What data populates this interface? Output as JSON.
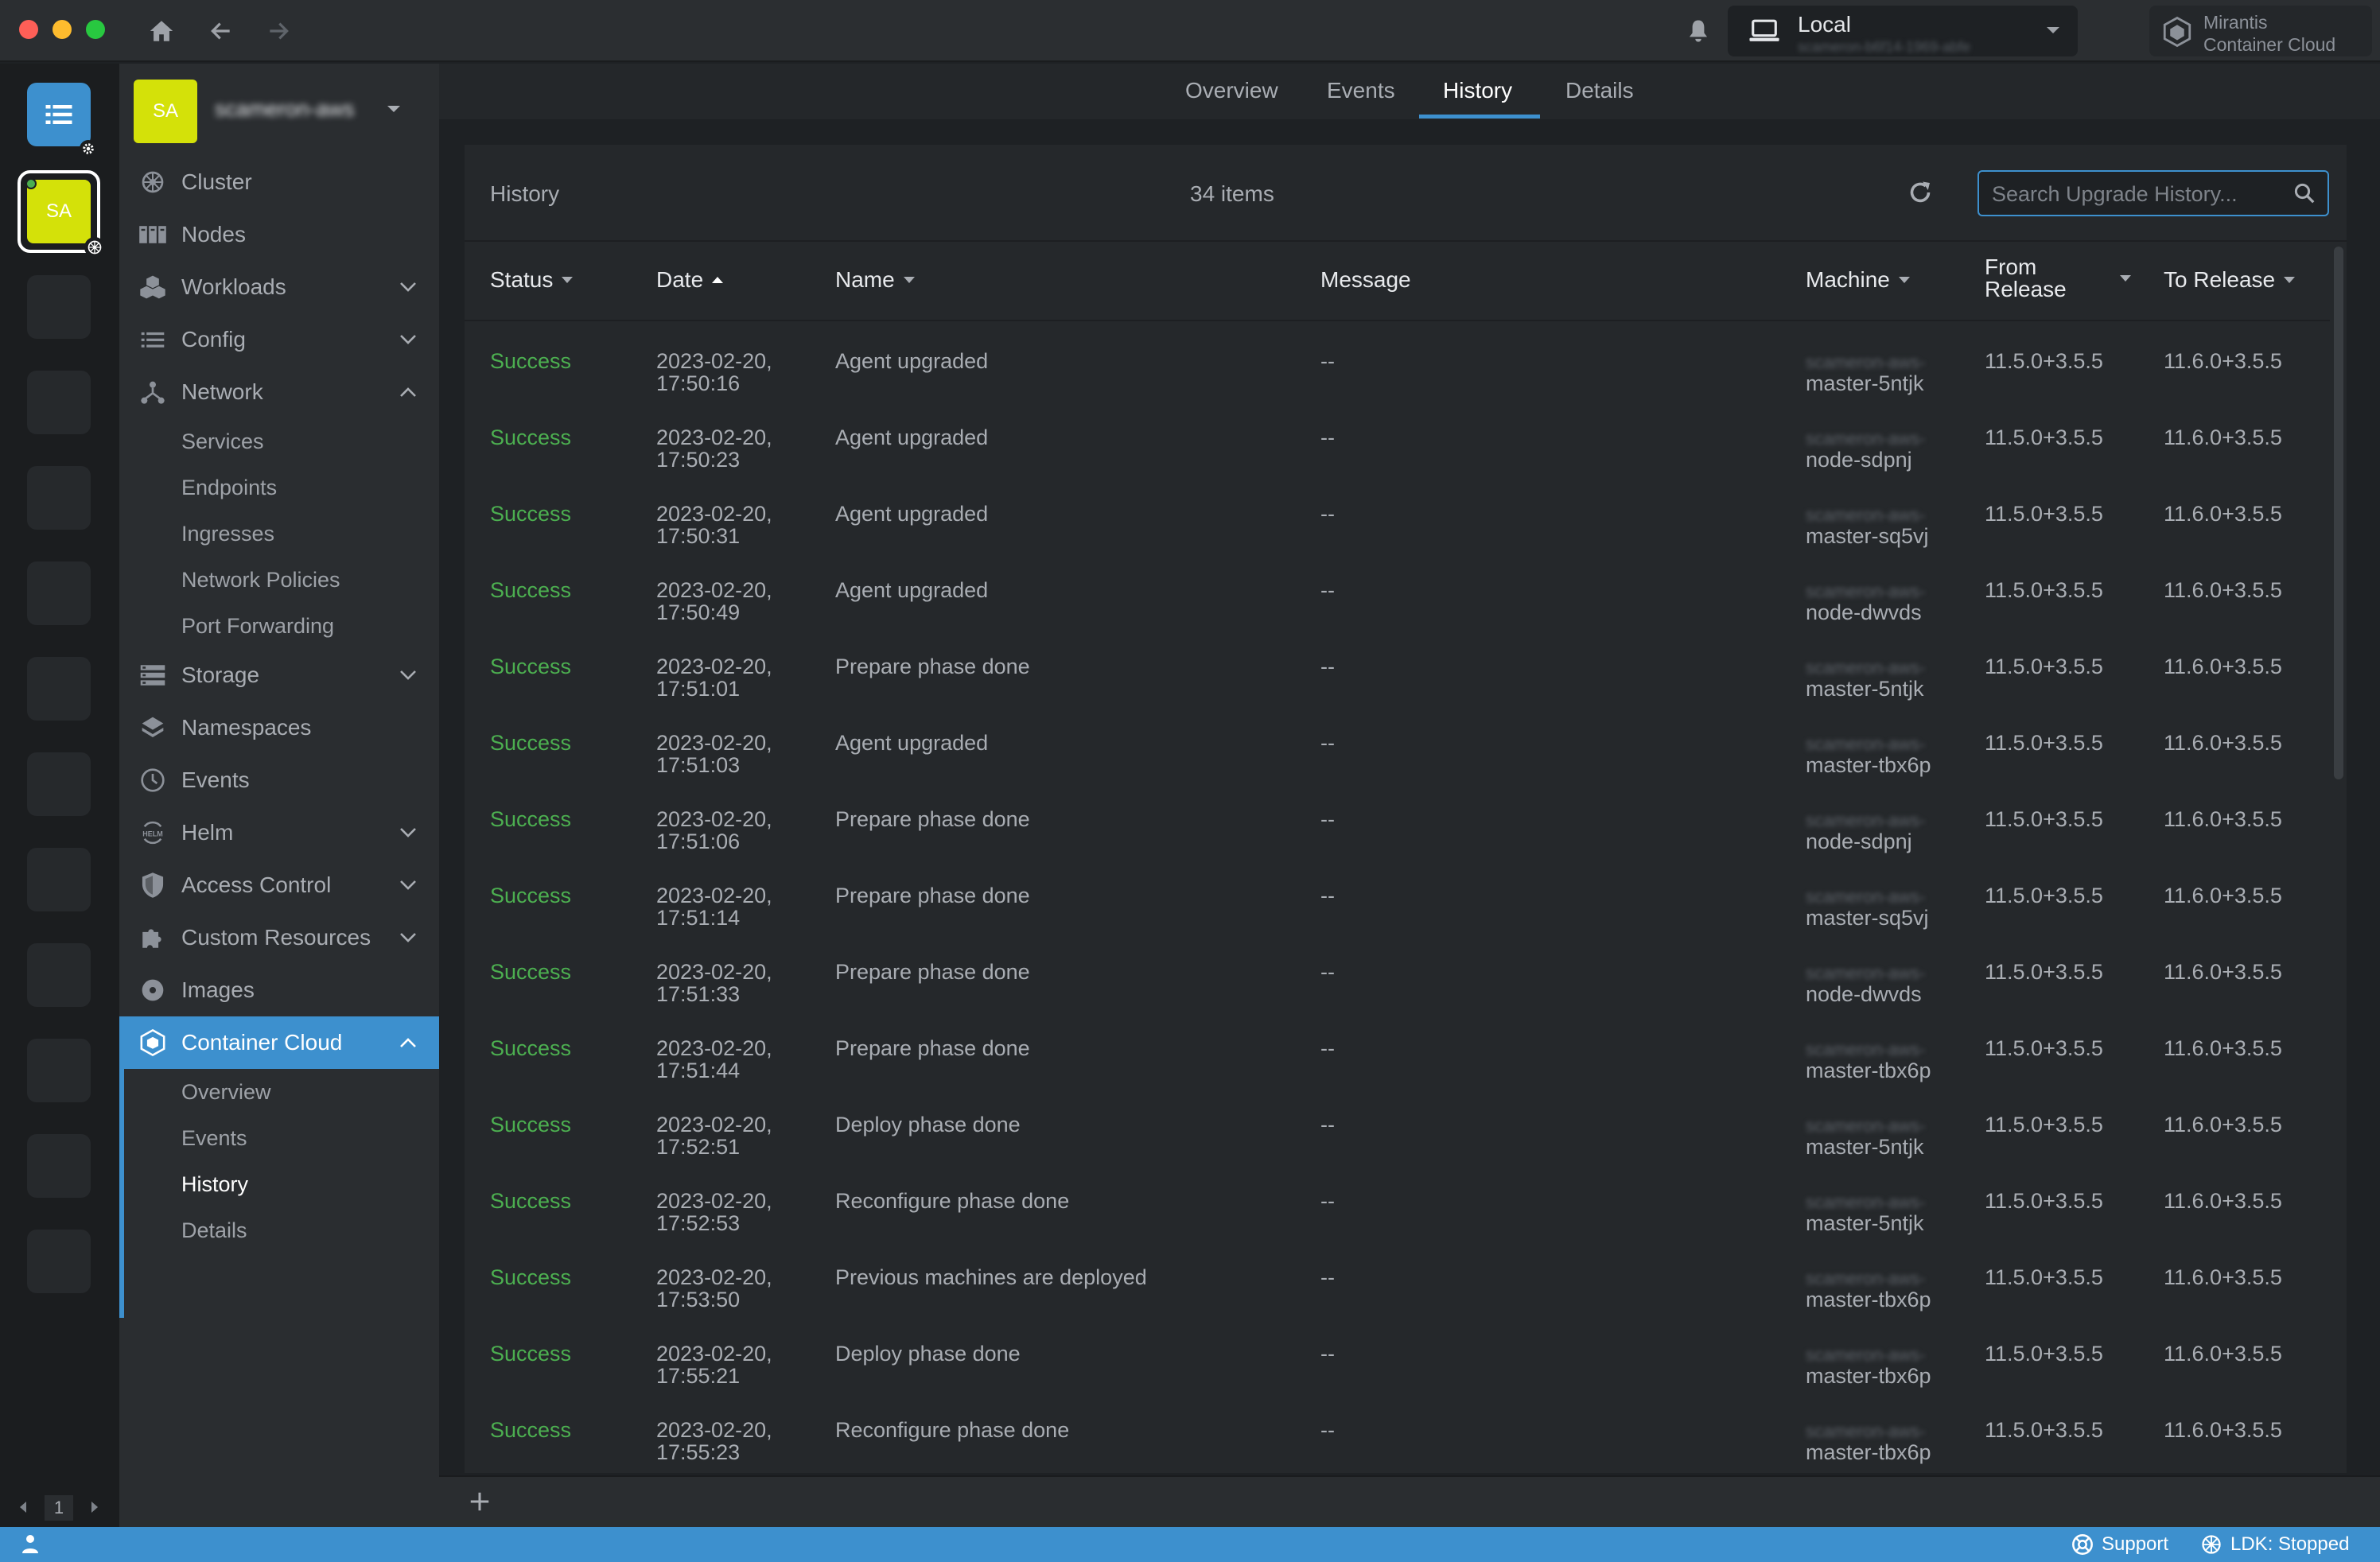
{
  "topbar": {
    "cluster_name": "Local",
    "cluster_id": "scameron-b6f14-1969-abfe",
    "brand_line1": "Mirantis",
    "brand_line2": "Container Cloud"
  },
  "hotbar": {
    "active_initials": "SA",
    "page": "1"
  },
  "workspace": {
    "initials": "SA",
    "name": "scameron-aws"
  },
  "sidebar": {
    "items": [
      {
        "label": "Cluster"
      },
      {
        "label": "Nodes"
      },
      {
        "label": "Workloads"
      },
      {
        "label": "Config"
      },
      {
        "label": "Network"
      },
      {
        "label": "Storage"
      },
      {
        "label": "Namespaces"
      },
      {
        "label": "Events"
      },
      {
        "label": "Helm"
      },
      {
        "label": "Access Control"
      },
      {
        "label": "Custom Resources"
      },
      {
        "label": "Images"
      },
      {
        "label": "Container Cloud"
      }
    ],
    "network_sub": [
      "Services",
      "Endpoints",
      "Ingresses",
      "Network Policies",
      "Port Forwarding"
    ],
    "cc_sub": [
      "Overview",
      "Events",
      "History",
      "Details"
    ]
  },
  "tabs": [
    "Overview",
    "Events",
    "History",
    "Details"
  ],
  "panel": {
    "title": "History",
    "count": "34 items",
    "search_placeholder": "Search Upgrade History..."
  },
  "table": {
    "headers": {
      "status": "Status",
      "date": "Date",
      "name": "Name",
      "message": "Message",
      "machine": "Machine",
      "from1": "From",
      "from2": "Release",
      "to": "To Release"
    },
    "rows": [
      {
        "status": "Success",
        "date1": "2023-02-20,",
        "date2": "17:50:16",
        "name": "Agent upgraded",
        "message": "--",
        "machine_prefix": "scameron-aws-",
        "machine": "master-5ntjk",
        "from": "11.5.0+3.5.5",
        "to": "11.6.0+3.5.5"
      },
      {
        "status": "Success",
        "date1": "2023-02-20,",
        "date2": "17:50:23",
        "name": "Agent upgraded",
        "message": "--",
        "machine_prefix": "scameron-aws-",
        "machine": "node-sdpnj",
        "from": "11.5.0+3.5.5",
        "to": "11.6.0+3.5.5"
      },
      {
        "status": "Success",
        "date1": "2023-02-20,",
        "date2": "17:50:31",
        "name": "Agent upgraded",
        "message": "--",
        "machine_prefix": "scameron-aws-",
        "machine": "master-sq5vj",
        "from": "11.5.0+3.5.5",
        "to": "11.6.0+3.5.5"
      },
      {
        "status": "Success",
        "date1": "2023-02-20,",
        "date2": "17:50:49",
        "name": "Agent upgraded",
        "message": "--",
        "machine_prefix": "scameron-aws-",
        "machine": "node-dwvds",
        "from": "11.5.0+3.5.5",
        "to": "11.6.0+3.5.5"
      },
      {
        "status": "Success",
        "date1": "2023-02-20,",
        "date2": "17:51:01",
        "name": "Prepare phase done",
        "message": "--",
        "machine_prefix": "scameron-aws-",
        "machine": "master-5ntjk",
        "from": "11.5.0+3.5.5",
        "to": "11.6.0+3.5.5"
      },
      {
        "status": "Success",
        "date1": "2023-02-20,",
        "date2": "17:51:03",
        "name": "Agent upgraded",
        "message": "--",
        "machine_prefix": "scameron-aws-",
        "machine": "master-tbx6p",
        "from": "11.5.0+3.5.5",
        "to": "11.6.0+3.5.5"
      },
      {
        "status": "Success",
        "date1": "2023-02-20,",
        "date2": "17:51:06",
        "name": "Prepare phase done",
        "message": "--",
        "machine_prefix": "scameron-aws-",
        "machine": "node-sdpnj",
        "from": "11.5.0+3.5.5",
        "to": "11.6.0+3.5.5"
      },
      {
        "status": "Success",
        "date1": "2023-02-20,",
        "date2": "17:51:14",
        "name": "Prepare phase done",
        "message": "--",
        "machine_prefix": "scameron-aws-",
        "machine": "master-sq5vj",
        "from": "11.5.0+3.5.5",
        "to": "11.6.0+3.5.5"
      },
      {
        "status": "Success",
        "date1": "2023-02-20,",
        "date2": "17:51:33",
        "name": "Prepare phase done",
        "message": "--",
        "machine_prefix": "scameron-aws-",
        "machine": "node-dwvds",
        "from": "11.5.0+3.5.5",
        "to": "11.6.0+3.5.5"
      },
      {
        "status": "Success",
        "date1": "2023-02-20,",
        "date2": "17:51:44",
        "name": "Prepare phase done",
        "message": "--",
        "machine_prefix": "scameron-aws-",
        "machine": "master-tbx6p",
        "from": "11.5.0+3.5.5",
        "to": "11.6.0+3.5.5"
      },
      {
        "status": "Success",
        "date1": "2023-02-20,",
        "date2": "17:52:51",
        "name": "Deploy phase done",
        "message": "--",
        "machine_prefix": "scameron-aws-",
        "machine": "master-5ntjk",
        "from": "11.5.0+3.5.5",
        "to": "11.6.0+3.5.5"
      },
      {
        "status": "Success",
        "date1": "2023-02-20,",
        "date2": "17:52:53",
        "name": "Reconfigure phase done",
        "message": "--",
        "machine_prefix": "scameron-aws-",
        "machine": "master-5ntjk",
        "from": "11.5.0+3.5.5",
        "to": "11.6.0+3.5.5"
      },
      {
        "status": "Success",
        "date1": "2023-02-20,",
        "date2": "17:53:50",
        "name": "Previous machines are deployed",
        "message": "--",
        "machine_prefix": "scameron-aws-",
        "machine": "master-tbx6p",
        "from": "11.5.0+3.5.5",
        "to": "11.6.0+3.5.5"
      },
      {
        "status": "Success",
        "date1": "2023-02-20,",
        "date2": "17:55:21",
        "name": "Deploy phase done",
        "message": "--",
        "machine_prefix": "scameron-aws-",
        "machine": "master-tbx6p",
        "from": "11.5.0+3.5.5",
        "to": "11.6.0+3.5.5"
      },
      {
        "status": "Success",
        "date1": "2023-02-20,",
        "date2": "17:55:23",
        "name": "Reconfigure phase done",
        "message": "--",
        "machine_prefix": "scameron-aws-",
        "machine": "master-tbx6p",
        "from": "11.5.0+3.5.5",
        "to": "11.6.0+3.5.5"
      }
    ]
  },
  "statusbar": {
    "support": "Support",
    "ldk": "LDK: Stopped"
  },
  "colors": {
    "accent": "#3d90ce",
    "success": "#4caf50",
    "workspace": "#d4e109"
  }
}
